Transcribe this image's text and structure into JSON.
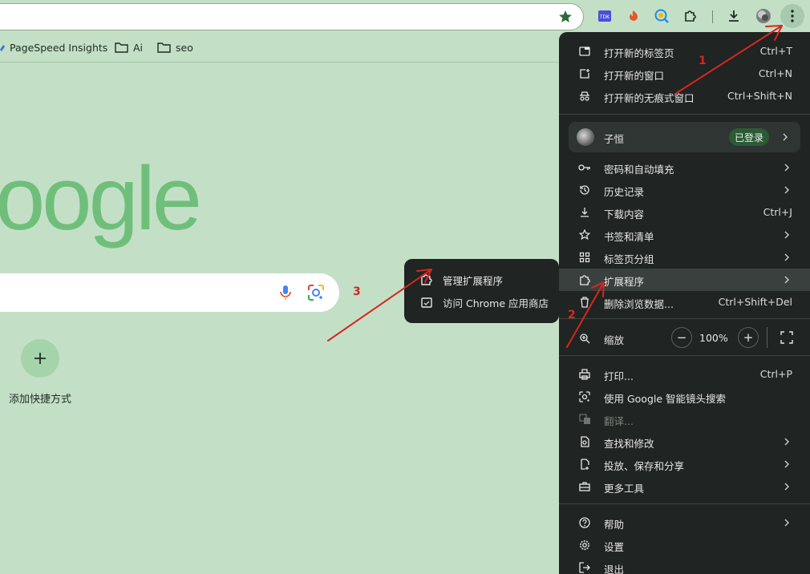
{
  "bookmarks": [
    {
      "label": "PageSpeed Insights",
      "icon": "pagespeed-icon"
    },
    {
      "label": "Ai",
      "icon": "folder-icon"
    },
    {
      "label": "seo",
      "icon": "folder-icon"
    }
  ],
  "ntp": {
    "logo_text": "oogle",
    "shortcut_label": "添加快捷方式"
  },
  "extensions_toolbar": [
    "tdk-icon",
    "extension-flame-icon",
    "seo-quake-icon",
    "puzzle-icon"
  ],
  "submenu": {
    "items": [
      {
        "label": "管理扩展程序",
        "icon": "puzzle-icon"
      },
      {
        "label": "访问 Chrome 应用商店",
        "icon": "web-store-icon"
      }
    ]
  },
  "menu": {
    "new_tab": {
      "label": "打开新的标签页",
      "shortcut": "Ctrl+T"
    },
    "new_window": {
      "label": "打开新的窗口",
      "shortcut": "Ctrl+N"
    },
    "incognito": {
      "label": "打开新的无痕式窗口",
      "shortcut": "Ctrl+Shift+N"
    },
    "profile": {
      "name": "子恒",
      "status": "已登录"
    },
    "passwords": {
      "label": "密码和自动填充"
    },
    "history": {
      "label": "历史记录"
    },
    "downloads": {
      "label": "下载内容",
      "shortcut": "Ctrl+J"
    },
    "bookmarks": {
      "label": "书签和清单"
    },
    "tab_groups": {
      "label": "标签页分组"
    },
    "extensions": {
      "label": "扩展程序"
    },
    "clear_data": {
      "label": "删除浏览数据...",
      "shortcut": "Ctrl+Shift+Del"
    },
    "zoom": {
      "label": "缩放",
      "value": "100%",
      "minus": "−",
      "plus": "+"
    },
    "print": {
      "label": "打印...",
      "shortcut": "Ctrl+P"
    },
    "lens": {
      "label": "使用 Google 智能镜头搜索"
    },
    "translate": {
      "label": "翻译..."
    },
    "find": {
      "label": "查找和修改"
    },
    "cast": {
      "label": "投放、保存和分享"
    },
    "more_tools": {
      "label": "更多工具"
    },
    "help": {
      "label": "帮助"
    },
    "settings": {
      "label": "设置"
    },
    "exit": {
      "label": "退出"
    }
  },
  "annotations": [
    "1",
    "2",
    "3"
  ],
  "colors": {
    "annotation": "#d8261f",
    "menu_bg": "#202422",
    "page_bg": "#c3e0c7",
    "logo": "#6fbf7a"
  }
}
